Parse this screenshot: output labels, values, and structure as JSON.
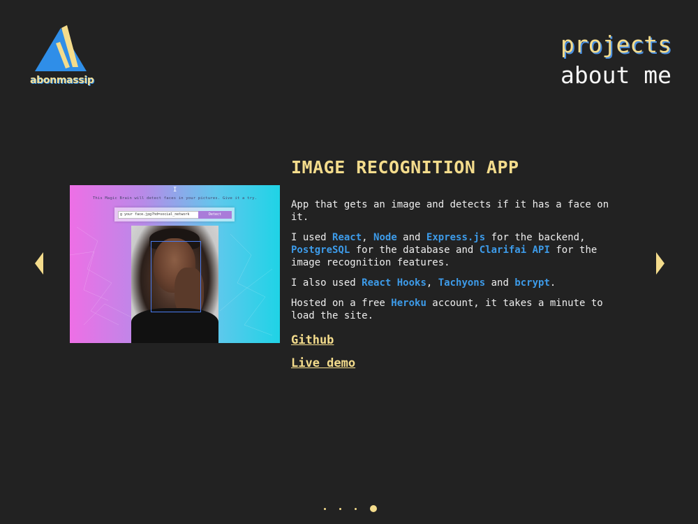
{
  "brand": {
    "name": "abonmassip"
  },
  "nav": {
    "projects": "projects",
    "about": "about me"
  },
  "project": {
    "title": "IMAGE RECOGNITION APP",
    "screenshot": {
      "caret": "I",
      "tagline": "This Magic Brain will detect faces in your pictures. Give it a try.",
      "url_value": "g your face.jpg?hd=social_network",
      "button": "Detect"
    },
    "para1": "App that gets an image and detects if it has a face on it.",
    "para2": {
      "t1": "I used ",
      "react": "React",
      "t2": ", ",
      "node": "Node",
      "t3": " and ",
      "express": "Express.js",
      "t4": " for the backend, ",
      "postgres": "PostgreSQL",
      "t5": " for the database and ",
      "clarifai": "Clarifai API",
      "t6": " for the image recognition features."
    },
    "para3": {
      "t1": "I also used ",
      "hooks": "React Hooks",
      "t2": ", ",
      "tachyons": "Tachyons",
      "t3": " and ",
      "bcrypt": "bcrypt",
      "t4": "."
    },
    "para4": {
      "t1": "Hosted on a free ",
      "heroku": "Heroku",
      "t2": " account, it takes a minute to load the site."
    },
    "links": {
      "github": "Github",
      "demo": "Live demo"
    }
  },
  "carousel": {
    "slide_count": 4,
    "active_index": 3
  },
  "colors": {
    "background": "#222222",
    "accent": "#f4dc8c",
    "tech": "#3d9be9",
    "logo_blue": "#2f8ee8"
  }
}
